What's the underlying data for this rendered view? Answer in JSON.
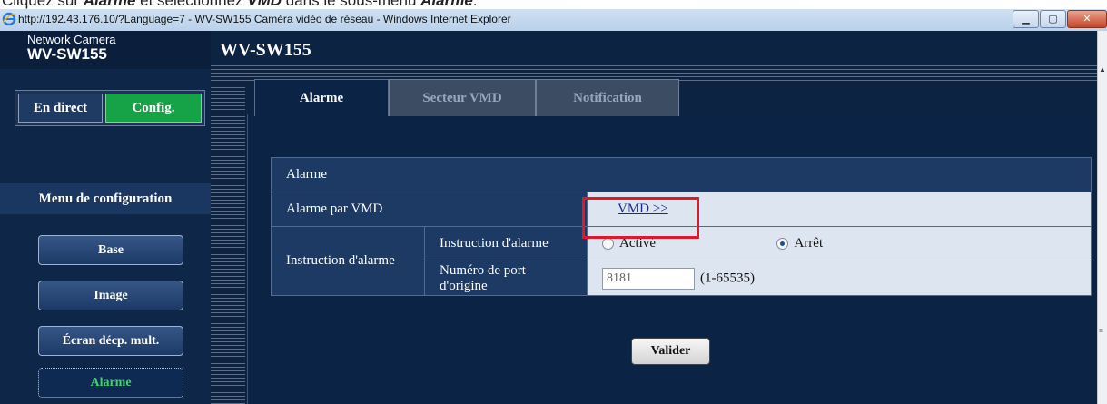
{
  "instruction": {
    "prefix": "Cliquez sur ",
    "alarme_word": "Alarme",
    "mid": " et sélectionnez ",
    "vmd_word": "VMD",
    "suffix": " dans le sous-menu ",
    "alarme_word2": "Alarme",
    "end": "."
  },
  "browser": {
    "title": "http://192.43.176.10/?Language=7 - WV-SW155 Caméra vidéo de réseau - Windows Internet Explorer",
    "min_icon": "minimize-icon",
    "max_icon": "maximize-icon",
    "close_icon": "close-icon"
  },
  "camera": {
    "brand_small": "Network Camera",
    "brand_model": "WV-SW155",
    "header_title": "WV-SW155"
  },
  "mode": {
    "live": "En direct",
    "config": "Config."
  },
  "sidebar": {
    "menu_title": "Menu de configuration",
    "items": [
      {
        "label": "Base"
      },
      {
        "label": "Image"
      },
      {
        "label": "Écran décp. mult."
      },
      {
        "label": "Alarme"
      }
    ]
  },
  "tabs": [
    {
      "label": "Alarme"
    },
    {
      "label": "Secteur VMD"
    },
    {
      "label": "Notification"
    }
  ],
  "table": {
    "section_header": "Alarme",
    "vmd_label": "Alarme par VMD",
    "vmd_link": "VMD >>",
    "instruction_group": "Instruction d'alarme",
    "instruction_row": "Instruction d'alarme",
    "radio_on": "Activé",
    "radio_off": "Arrêt",
    "port_label": "Numéro de port d'origine",
    "port_value": "8181",
    "port_range": "(1-65535)"
  },
  "valider": "Valider",
  "colors": {
    "accent_green": "#16a348",
    "highlight_red": "#e1182c",
    "page_bg": "#0c2342"
  }
}
